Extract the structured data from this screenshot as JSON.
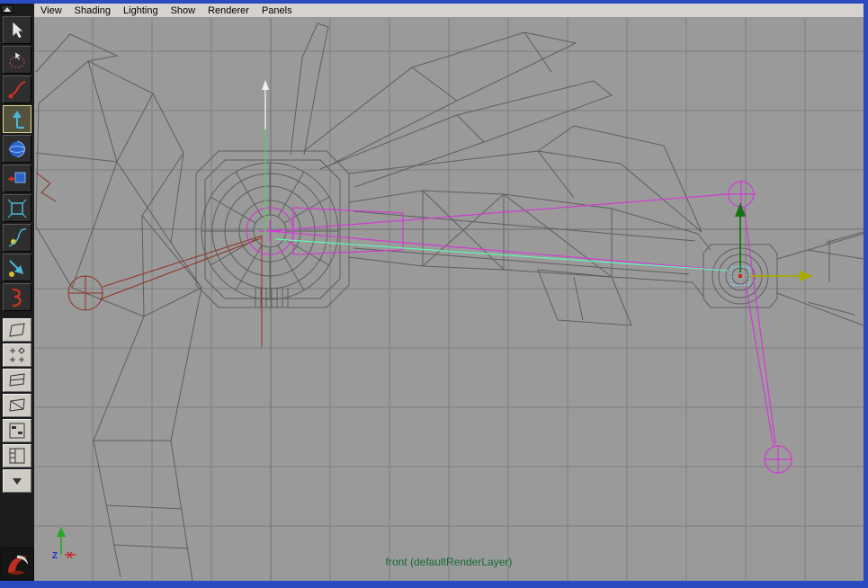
{
  "window": {
    "border_color": "#2a4cc0"
  },
  "menu_bar": {
    "items": [
      "View",
      "Shading",
      "Lighting",
      "Show",
      "Renderer",
      "Panels"
    ]
  },
  "toolbox": {
    "scroll_button_icon": "up-triangle",
    "tools": [
      {
        "id": "select-tool",
        "icon": "cursor-arrow-icon",
        "selected": false
      },
      {
        "id": "lasso-select-tool",
        "icon": "lasso-icon",
        "selected": false
      },
      {
        "id": "paint-select-tool",
        "icon": "paint-brush-icon",
        "selected": false
      },
      {
        "id": "move-tool",
        "icon": "move-manipulator-icon",
        "selected": true
      },
      {
        "id": "rotate-tool",
        "icon": "rotate-sphere-icon",
        "selected": false
      },
      {
        "id": "scale-tool",
        "icon": "scale-cube-icon",
        "selected": false
      },
      {
        "id": "universal-manipulator-tool",
        "icon": "universal-manipulator-icon",
        "selected": false
      },
      {
        "id": "soft-mod-tool",
        "icon": "soft-mod-icon",
        "selected": false
      },
      {
        "id": "show-manipulator-tool",
        "icon": "show-manipulator-icon",
        "selected": false
      },
      {
        "id": "last-tool-used",
        "icon": "last-tool-icon",
        "selected": false
      }
    ],
    "layout_buttons": [
      {
        "id": "single-pane-layout",
        "icon": "single-pane-icon"
      },
      {
        "id": "saved-layouts-grid",
        "icon": "plus-diamond-grid-icon"
      },
      {
        "id": "two-pane-layout",
        "icon": "stacked-panes-icon"
      },
      {
        "id": "diagonal-pane-layout",
        "icon": "diagonal-pane-icon"
      },
      {
        "id": "hypergraph-pane-layout",
        "icon": "hypergraph-pane-icon"
      },
      {
        "id": "outliner-pane-layout",
        "icon": "outliner-pane-icon"
      },
      {
        "id": "layout-menu-dropdown",
        "icon": "down-arrow-icon"
      }
    ],
    "logo_icon": "maya-logo"
  },
  "viewport": {
    "camera_label": "front (defaultRenderLayer)",
    "axis_labels": {
      "x": "X",
      "z": "Z"
    },
    "colors": {
      "background": "#9a9a9a",
      "grid_line": "#7e7e7e",
      "wireframe": "#5e5e5e",
      "selection_magenta": "#d23bd2",
      "ik_spline_cyan": "#63f7b4",
      "manipulator_green": "#117711",
      "manipulator_yellow": "#a8a800",
      "pole_vector_red": "#8f3222",
      "camera_label_color": "#156b33",
      "axis_x_color": "#cc2222",
      "axis_y_color": "#22aa22",
      "axis_z_color": "#2233cc"
    }
  }
}
